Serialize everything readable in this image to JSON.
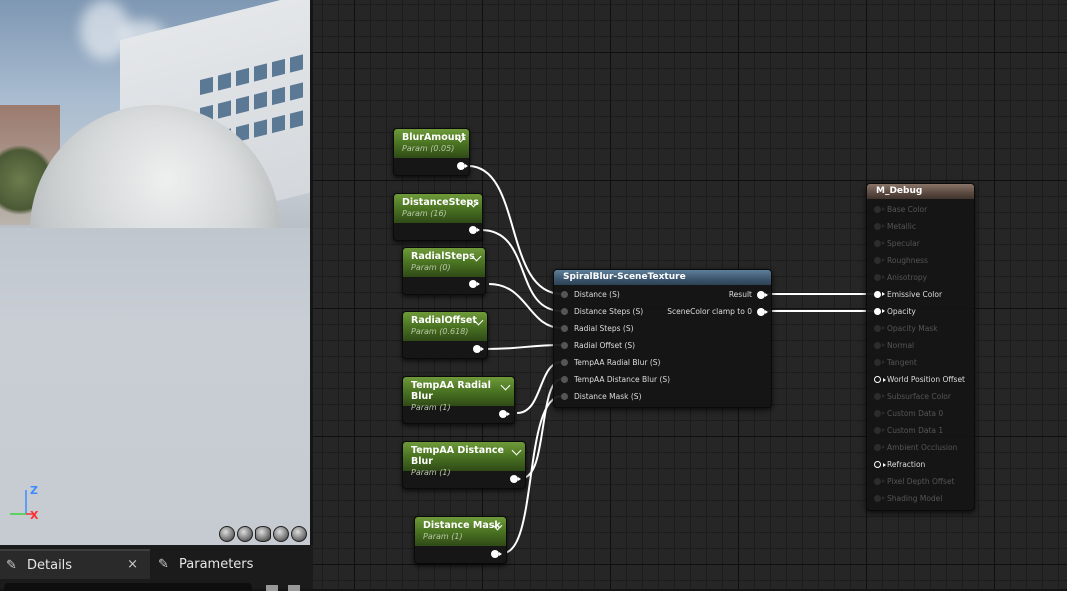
{
  "viewport": {
    "axis": {
      "z": "Z",
      "x": "X"
    },
    "toolbar_icons": [
      "cylinder-icon",
      "sphere-icon",
      "plane-icon",
      "cube-icon",
      "teapot-icon"
    ]
  },
  "tabs": {
    "details": {
      "label": "Details",
      "close": "×"
    },
    "parameters": {
      "label": "Parameters"
    }
  },
  "param_nodes": [
    {
      "title": "BlurAmount",
      "subtitle": "Param (0.05)"
    },
    {
      "title": "DistanceSteps",
      "subtitle": "Param (16)"
    },
    {
      "title": "RadialSteps",
      "subtitle": "Param (0)"
    },
    {
      "title": "RadialOffset",
      "subtitle": "Param (0.618)"
    },
    {
      "title": "TempAA Radial Blur",
      "subtitle": "Param (1)"
    },
    {
      "title": "TempAA Distance Blur",
      "subtitle": "Param (1)"
    },
    {
      "title": "Distance Mask",
      "subtitle": "Param (1)"
    }
  ],
  "spiral_node": {
    "title": "SpiralBlur-SceneTexture",
    "inputs": [
      "Distance (S)",
      "Distance Steps (S)",
      "Radial Steps (S)",
      "Radial Offset (S)",
      "TempAA Radial Blur (S)",
      "TempAA Distance Blur (S)",
      "Distance Mask (S)"
    ],
    "outputs": [
      "Result",
      "SceneColor clamp to 0"
    ]
  },
  "material_node": {
    "title": "M_Debug",
    "inputs": [
      {
        "label": "Base Color",
        "state": "dim"
      },
      {
        "label": "Metallic",
        "state": "dim"
      },
      {
        "label": "Specular",
        "state": "dim"
      },
      {
        "label": "Roughness",
        "state": "dim"
      },
      {
        "label": "Anisotropy",
        "state": "dim"
      },
      {
        "label": "Emissive Color",
        "state": "connected"
      },
      {
        "label": "Opacity",
        "state": "connected"
      },
      {
        "label": "Opacity Mask",
        "state": "dim"
      },
      {
        "label": "Normal",
        "state": "dim"
      },
      {
        "label": "Tangent",
        "state": "dim"
      },
      {
        "label": "World Position Offset",
        "state": "active"
      },
      {
        "label": "Subsurface Color",
        "state": "dim"
      },
      {
        "label": "Custom Data 0",
        "state": "dim"
      },
      {
        "label": "Custom Data 1",
        "state": "dim"
      },
      {
        "label": "Ambient Occlusion",
        "state": "dim"
      },
      {
        "label": "Refraction",
        "state": "active"
      },
      {
        "label": "Pixel Depth Offset",
        "state": "dim"
      },
      {
        "label": "Shading Model",
        "state": "dim"
      }
    ]
  },
  "colors": {
    "param_header": "#4a7322",
    "spiral_header": "#3c566e",
    "material_header": "#5b4a40",
    "wire": "#ffffff",
    "axis_z": "#3d8cff",
    "axis_x": "#ff3030",
    "axis_y": "#3bd13b"
  }
}
